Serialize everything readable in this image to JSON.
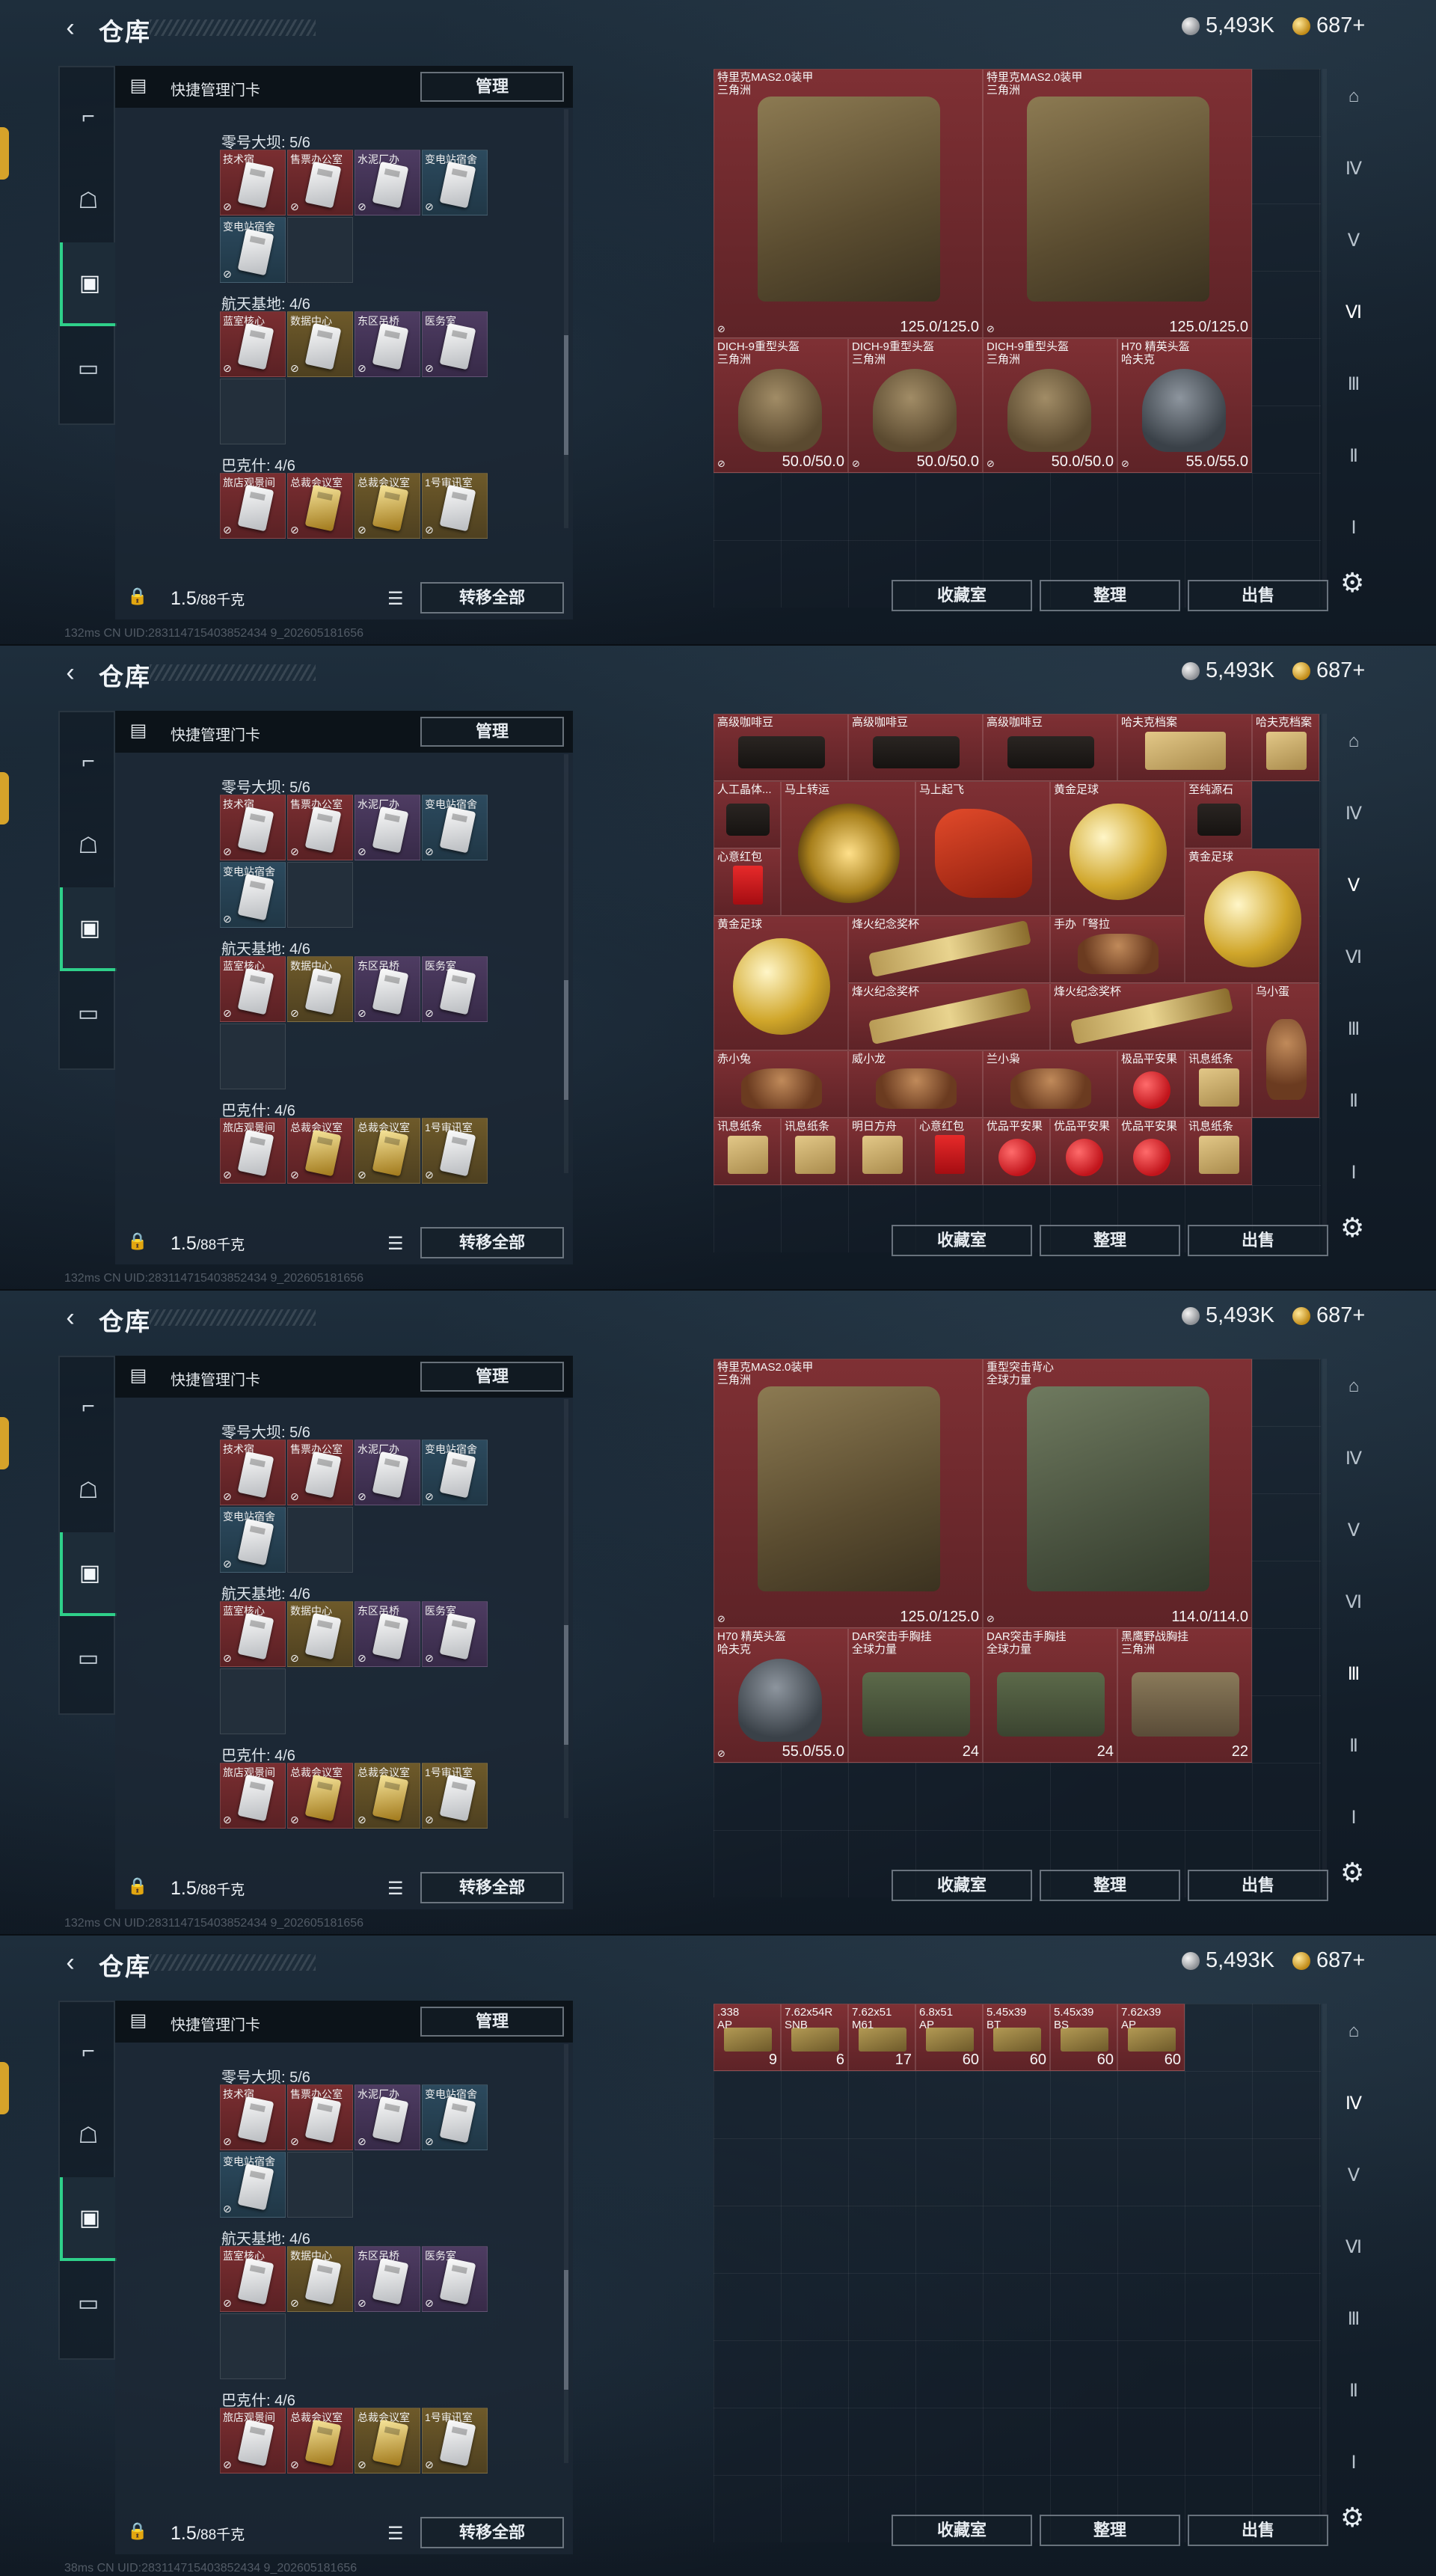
{
  "header": {
    "title": "仓库",
    "back_icon": "chevron-left-icon",
    "currency_silver": "5,493K",
    "currency_gold": "687+"
  },
  "left_panel": {
    "keycard_manager_label": "快捷管理门卡",
    "manage_label": "管理",
    "sections": [
      {
        "title": "零号大坝: 5/6",
        "cards": [
          {
            "label": "技术宿",
            "color": "red",
            "kind": "silver"
          },
          {
            "label": "售票办公室",
            "color": "red",
            "kind": "silver"
          },
          {
            "label": "水泥厂办",
            "color": "purple",
            "kind": "silver"
          },
          {
            "label": "变电站宿舍",
            "color": "blue",
            "kind": "silver"
          },
          {
            "label": "变电站宿舍",
            "color": "blue",
            "kind": "silver"
          }
        ]
      },
      {
        "title": "航天基地: 4/6",
        "cards": [
          {
            "label": "蓝室核心",
            "color": "red",
            "kind": "silver"
          },
          {
            "label": "数据中心",
            "color": "gold",
            "kind": "silver"
          },
          {
            "label": "东区吊桥",
            "color": "purple",
            "kind": "silver"
          },
          {
            "label": "医务室",
            "color": "purple",
            "kind": "silver"
          }
        ]
      },
      {
        "title": "巴克什: 4/6",
        "cards": [
          {
            "label": "旅店观景间",
            "color": "red",
            "kind": "silver"
          },
          {
            "label": "总裁会议室",
            "color": "red",
            "kind": "gold"
          },
          {
            "label": "总裁会议室",
            "color": "gold",
            "kind": "gold"
          },
          {
            "label": "1号审讯室",
            "color": "gold",
            "kind": "silver"
          }
        ]
      }
    ],
    "capacity_value": "1.5",
    "capacity_unit": "/88千克",
    "transfer_all_label": "转移全部"
  },
  "actions": {
    "collection_label": "收藏室",
    "sort_label": "整理",
    "sell_label": "出售"
  },
  "right_icons": [
    "helmet-slot-icon",
    "armor-tier-4-icon",
    "armor-tier-5-icon",
    "armor-tier-6-icon",
    "armor-tier-3-icon",
    "armor-tier-2-icon",
    "armor-tier-1-icon"
  ],
  "views": [
    {
      "uid": "132ms CN UID:283114715403852434 9_202605181656",
      "active_icon": 3,
      "items": [
        {
          "name": "特里克MAS2.0装甲\n三角洲",
          "value": "125.0/125.0",
          "color": "red",
          "art": "vest"
        },
        {
          "name": "特里克MAS2.0装甲\n三角洲",
          "value": "125.0/125.0",
          "color": "red",
          "art": "vest"
        },
        {
          "name": "DICH-9重型头盔\n三角洲",
          "value": "50.0/50.0",
          "color": "red",
          "art": "helmet"
        },
        {
          "name": "DICH-9重型头盔\n三角洲",
          "value": "50.0/50.0",
          "color": "red",
          "art": "helmet"
        },
        {
          "name": "DICH-9重型头盔\n三角洲",
          "value": "50.0/50.0",
          "color": "red",
          "art": "helmet"
        },
        {
          "name": "H70 精英头盔\n哈夫克",
          "value": "55.0/55.0",
          "color": "red",
          "art": "helmet-grey"
        }
      ]
    },
    {
      "uid": "132ms CN UID:283114715403852434 9_202605181656",
      "active_icon": 2,
      "items": [
        {
          "name": "高级咖啡豆",
          "value": "",
          "color": "red",
          "art": "coffee"
        },
        {
          "name": "高级咖啡豆",
          "value": "",
          "color": "red",
          "art": "coffee"
        },
        {
          "name": "高级咖啡豆",
          "value": "",
          "color": "red",
          "art": "coffee"
        },
        {
          "name": "哈夫克档案",
          "value": "",
          "color": "red",
          "art": "paper"
        },
        {
          "name": "哈夫克档案",
          "value": "",
          "color": "red",
          "art": "paper"
        },
        {
          "name": "人工晶体...",
          "value": "",
          "color": "red",
          "art": "coffee"
        },
        {
          "name": "马上转运",
          "value": "",
          "color": "red",
          "art": "wheel"
        },
        {
          "name": "马上起飞",
          "value": "",
          "color": "red",
          "art": "horse"
        },
        {
          "name": "黄金足球",
          "value": "",
          "color": "red",
          "art": "ball"
        },
        {
          "name": "至纯源石",
          "value": "",
          "color": "red",
          "art": "coffee"
        },
        {
          "name": "心意红包",
          "value": "",
          "color": "red",
          "art": "redenv"
        },
        {
          "name": "黄金足球",
          "value": "",
          "color": "red",
          "art": "ball"
        },
        {
          "name": "黄金足球",
          "value": "",
          "color": "red",
          "art": "ball"
        },
        {
          "name": "烽火纪念奖杯",
          "value": "",
          "color": "red",
          "art": "cup"
        },
        {
          "name": "手办「弩拉",
          "value": "",
          "color": "red",
          "art": "figure"
        },
        {
          "name": "烽火纪念奖杯",
          "value": "",
          "color": "red",
          "art": "cup"
        },
        {
          "name": "烽火纪念奖杯",
          "value": "",
          "color": "red",
          "art": "cup"
        },
        {
          "name": "乌小蛋",
          "value": "",
          "color": "red",
          "art": "figure"
        },
        {
          "name": "赤小兔",
          "value": "",
          "color": "red",
          "art": "figure"
        },
        {
          "name": "威小龙",
          "value": "",
          "color": "red",
          "art": "figure"
        },
        {
          "name": "兰小枭",
          "value": "",
          "color": "red",
          "art": "figure"
        },
        {
          "name": "极品平安果",
          "value": "",
          "color": "red",
          "art": "apple"
        },
        {
          "name": "讯息纸条",
          "value": "",
          "color": "red",
          "art": "paper"
        },
        {
          "name": "讯息纸条",
          "value": "",
          "color": "red",
          "art": "paper"
        },
        {
          "name": "讯息纸条",
          "value": "",
          "color": "red",
          "art": "paper"
        },
        {
          "name": "明日方舟",
          "value": "",
          "color": "red",
          "art": "paper"
        },
        {
          "name": "心意红包",
          "value": "",
          "color": "red",
          "art": "redenv"
        },
        {
          "name": "优品平安果",
          "value": "",
          "color": "red",
          "art": "apple"
        },
        {
          "name": "优品平安果",
          "value": "",
          "color": "red",
          "art": "apple"
        },
        {
          "name": "优品平安果",
          "value": "",
          "color": "red",
          "art": "apple"
        },
        {
          "name": "讯息纸条",
          "value": "",
          "color": "red",
          "art": "paper"
        }
      ]
    },
    {
      "uid": "132ms CN UID:283114715403852434 9_202605181656",
      "active_icon": 4,
      "items": [
        {
          "name": "特里克MAS2.0装甲\n三角洲",
          "value": "125.0/125.0",
          "color": "red",
          "art": "vest"
        },
        {
          "name": "重型突击背心\n全球力量",
          "value": "114.0/114.0",
          "color": "red",
          "art": "vest-green"
        },
        {
          "name": "H70 精英头盔\n哈夫克",
          "value": "55.0/55.0",
          "color": "red",
          "art": "helmet-grey"
        },
        {
          "name": "DAR突击手胸挂\n全球力量",
          "value": "24",
          "color": "red",
          "art": "bag"
        },
        {
          "name": "DAR突击手胸挂\n全球力量",
          "value": "24",
          "color": "red",
          "art": "bag"
        },
        {
          "name": "黑鹰野战胸挂\n三角洲",
          "value": "22",
          "color": "red",
          "art": "bag-tan"
        }
      ]
    },
    {
      "uid": "38ms CN UID:283114715403852434 9_202605181656",
      "active_icon": 1,
      "items": [
        {
          "name": ".338\nAP",
          "value": "9",
          "color": "red",
          "art": "ammo"
        },
        {
          "name": "7.62x54R\nSNB",
          "value": "6",
          "color": "red",
          "art": "ammo"
        },
        {
          "name": "7.62x51\nM61",
          "value": "17",
          "color": "red",
          "art": "ammo"
        },
        {
          "name": "6.8x51\nAP",
          "value": "60",
          "color": "red",
          "art": "ammo"
        },
        {
          "name": "5.45x39\nBT",
          "value": "60",
          "color": "red",
          "art": "ammo"
        },
        {
          "name": "5.45x39\nBS",
          "value": "60",
          "color": "red",
          "art": "ammo"
        },
        {
          "name": "7.62x39\nAP",
          "value": "60",
          "color": "red",
          "art": "ammo"
        }
      ]
    }
  ]
}
